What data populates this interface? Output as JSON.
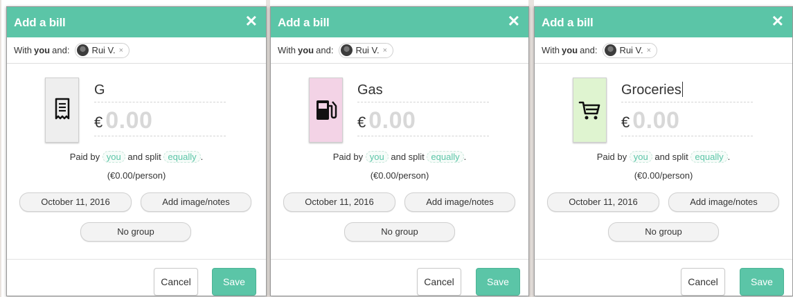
{
  "modals": [
    {
      "title": "Add a bill",
      "with_label": "With",
      "with_you": "you",
      "with_and": "and:",
      "friend_name": "Rui V.",
      "remove_friend": "×",
      "category_icon": "receipt-icon",
      "category_color": "#eeeeee",
      "description": "G",
      "currency": "€",
      "amount_placeholder": "0.00",
      "paid_by_text": "Paid by",
      "payer": "you",
      "split_text": "and split",
      "split_mode": "equally",
      "period": ".",
      "per_person": "(€0.00/person)",
      "date": "October 11, 2016",
      "notes_button": "Add image/notes",
      "group_button": "No group",
      "cancel": "Cancel",
      "save": "Save",
      "close": "✕"
    },
    {
      "title": "Add a bill",
      "with_label": "With",
      "with_you": "you",
      "with_and": "and:",
      "friend_name": "Rui V.",
      "remove_friend": "×",
      "category_icon": "gas-pump-icon",
      "category_color": "#f3d3e6",
      "description": "Gas",
      "currency": "€",
      "amount_placeholder": "0.00",
      "paid_by_text": "Paid by",
      "payer": "you",
      "split_text": "and split",
      "split_mode": "equally",
      "period": ".",
      "per_person": "(€0.00/person)",
      "date": "October 11, 2016",
      "notes_button": "Add image/notes",
      "group_button": "No group",
      "cancel": "Cancel",
      "save": "Save",
      "close": "✕"
    },
    {
      "title": "Add a bill",
      "with_label": "With",
      "with_you": "you",
      "with_and": "and:",
      "friend_name": "Rui V.",
      "remove_friend": "×",
      "category_icon": "shopping-cart-icon",
      "category_color": "#dff4d0",
      "description": "Groceries",
      "currency": "€",
      "amount_placeholder": "0.00",
      "paid_by_text": "Paid by",
      "payer": "you",
      "split_text": "and split",
      "split_mode": "equally",
      "period": ".",
      "per_person": "(€0.00/person)",
      "date": "October 11, 2016",
      "notes_button": "Add image/notes",
      "group_button": "No group",
      "cancel": "Cancel",
      "save": "Save",
      "close": "✕"
    }
  ],
  "colors": {
    "accent": "#5bc5a7",
    "placeholder": "#d8d8d8"
  }
}
